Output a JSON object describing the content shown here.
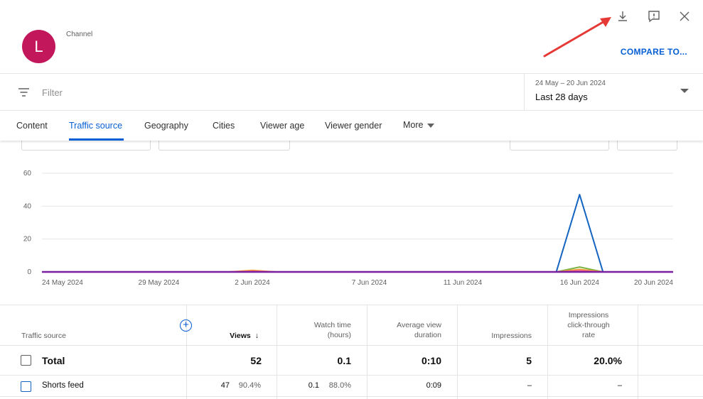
{
  "header": {
    "avatar_letter": "L",
    "channel_label": "Channel",
    "compare_label": "COMPARE TO...",
    "icons": [
      "download-icon",
      "feedback-icon",
      "close-icon"
    ]
  },
  "filter": {
    "placeholder": "Filter",
    "date_range": "24 May – 20 Jun 2024",
    "date_period": "Last 28 days"
  },
  "tabs": [
    {
      "label": "Content"
    },
    {
      "label": "Traffic source",
      "active": true
    },
    {
      "label": "Geography"
    },
    {
      "label": "Cities"
    },
    {
      "label": "Viewer age"
    },
    {
      "label": "Viewer gender"
    },
    {
      "label": "More"
    }
  ],
  "chart_data": {
    "type": "line",
    "ylim": [
      0,
      60
    ],
    "yticks": [
      "0",
      "20",
      "40",
      "60"
    ],
    "xtick_labels": [
      "24 May 2024",
      "29 May 2024",
      "2 Jun 2024",
      "7 Jun 2024",
      "11 Jun 2024",
      "16 Jun 2024",
      "20 Jun 2024"
    ],
    "grid": true,
    "series": [
      {
        "color": "#1565c0",
        "values": [
          0,
          0,
          0,
          0,
          0,
          0,
          0,
          0,
          0,
          0,
          0,
          0,
          0,
          0,
          0,
          0,
          0,
          0,
          0,
          0,
          0,
          0,
          0,
          47,
          0,
          0,
          0,
          0
        ]
      },
      {
        "color": "#7cb342",
        "values": [
          0,
          0,
          0,
          0,
          0,
          0,
          0,
          0,
          0,
          0,
          0,
          0,
          0,
          0,
          0,
          0,
          0,
          0,
          0,
          0,
          0,
          0,
          0,
          3,
          0,
          0,
          0,
          0
        ]
      },
      {
        "color": "#f9a825",
        "values": [
          0,
          0,
          0,
          0,
          0,
          0,
          0,
          0,
          0,
          1,
          0,
          0,
          0,
          0,
          0,
          0,
          0,
          0,
          0,
          0,
          0,
          0,
          0,
          1.5,
          0,
          0,
          0,
          0
        ]
      },
      {
        "color": "#ef6c7a",
        "values": [
          0,
          0,
          0,
          0,
          0,
          0,
          0,
          0,
          0,
          0.5,
          0,
          0,
          0,
          0,
          0,
          0,
          0,
          0,
          0,
          0,
          0,
          0,
          0,
          1,
          0,
          0,
          0,
          0
        ]
      },
      {
        "color": "#7b1fa2",
        "values": [
          0,
          0,
          0,
          0,
          0,
          0,
          0,
          0,
          0,
          0,
          0,
          0,
          0,
          0,
          0,
          0,
          0,
          0,
          0,
          0,
          0,
          0,
          0,
          0,
          0,
          0,
          0,
          0
        ]
      }
    ]
  },
  "table": {
    "headers": {
      "source": "Traffic source",
      "views": "Views",
      "watch_time_1": "Watch time",
      "watch_time_2": "(hours)",
      "avd_1": "Average view",
      "avd_2": "duration",
      "impressions": "Impressions",
      "ctr_1": "Impressions",
      "ctr_2": "click-through",
      "ctr_3": "rate"
    },
    "total": {
      "label": "Total",
      "views": "52",
      "watch_time": "0.1",
      "avd": "0:10",
      "impressions": "5",
      "ctr": "20.0%"
    },
    "rows": [
      {
        "label": "Shorts feed",
        "views": "47",
        "views_pct": "90.4%",
        "watch_time": "0.1",
        "watch_time_pct": "88.0%",
        "avd": "0:09",
        "impressions": "–",
        "ctr": "–"
      }
    ]
  },
  "colors": {
    "accent": "#065fd4",
    "avatar": "#c2185b",
    "annotation_arrow": "#e53935"
  }
}
